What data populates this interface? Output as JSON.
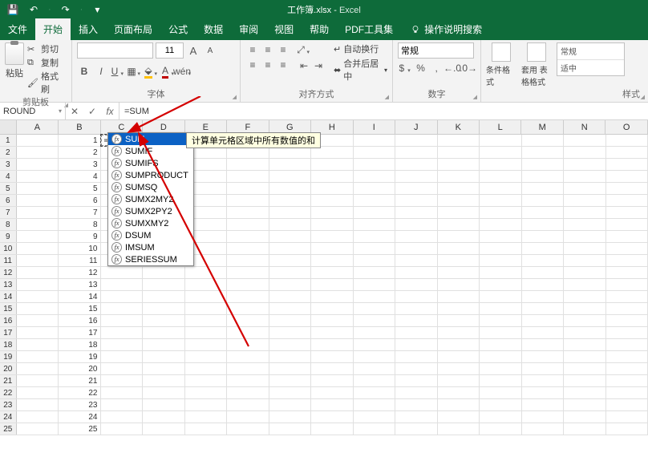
{
  "title": {
    "filename": "工作簿.xlsx",
    "app": "Excel",
    "sep": " - "
  },
  "qat": {
    "save": "💾",
    "undo": "↶",
    "redo": "↷",
    "more": "▾"
  },
  "tabs": {
    "file": "文件",
    "home": "开始",
    "insert": "插入",
    "layout": "页面布局",
    "formulas": "公式",
    "data": "数据",
    "review": "审阅",
    "view": "视图",
    "help": "帮助",
    "pdf": "PDF工具集"
  },
  "tellme": "操作说明搜索",
  "ribbon": {
    "clipboard": {
      "label": "剪贴板",
      "paste": "粘贴",
      "cut": "剪切",
      "copy": "复制",
      "painter": "格式刷"
    },
    "font": {
      "label": "字体",
      "name_placeholder": "",
      "size": "11",
      "bold": "B",
      "italic": "I",
      "underline": "U",
      "grow": "A",
      "shrink": "A"
    },
    "align": {
      "label": "对齐方式",
      "wrap": "自动换行",
      "merge": "合并后居中"
    },
    "number": {
      "label": "数字",
      "format": "常规",
      "currency": "%",
      "comma": ",",
      "dec_inc": ".0",
      "dec_dec": ".00"
    },
    "styles": {
      "cond": "条件格式",
      "table": "套用\n表格格式",
      "normal": "常规",
      "good": "适中",
      "label": "样式"
    }
  },
  "formula_bar": {
    "namebox": "ROUND",
    "cancel": "✕",
    "enter": "✓",
    "fx": "fx",
    "value": "=SUM"
  },
  "columns": [
    "A",
    "B",
    "C",
    "D",
    "E",
    "F",
    "G",
    "H",
    "I",
    "J",
    "K",
    "L",
    "M",
    "N",
    "O"
  ],
  "rows": [
    1,
    2,
    3,
    4,
    5,
    6,
    7,
    8,
    9,
    10,
    11,
    12,
    13,
    14,
    15,
    16,
    17,
    18,
    19,
    20,
    21,
    22,
    23,
    24,
    25
  ],
  "cells": {
    "B": [
      1,
      2,
      3,
      4,
      5,
      6,
      7,
      8,
      9,
      10,
      11,
      12,
      13,
      14,
      15,
      16,
      17,
      18,
      19,
      20,
      21,
      22,
      23,
      24,
      25
    ],
    "C1_edit": "=SUM"
  },
  "autocomplete": {
    "items": [
      "SUM",
      "SUMIF",
      "SUMIFS",
      "SUMPRODUCT",
      "SUMSQ",
      "SUMX2MY2",
      "SUMX2PY2",
      "SUMXMY2",
      "DSUM",
      "IMSUM",
      "SERIESSUM"
    ],
    "selected": 0,
    "tooltip": "计算单元格区域中所有数值的和"
  }
}
